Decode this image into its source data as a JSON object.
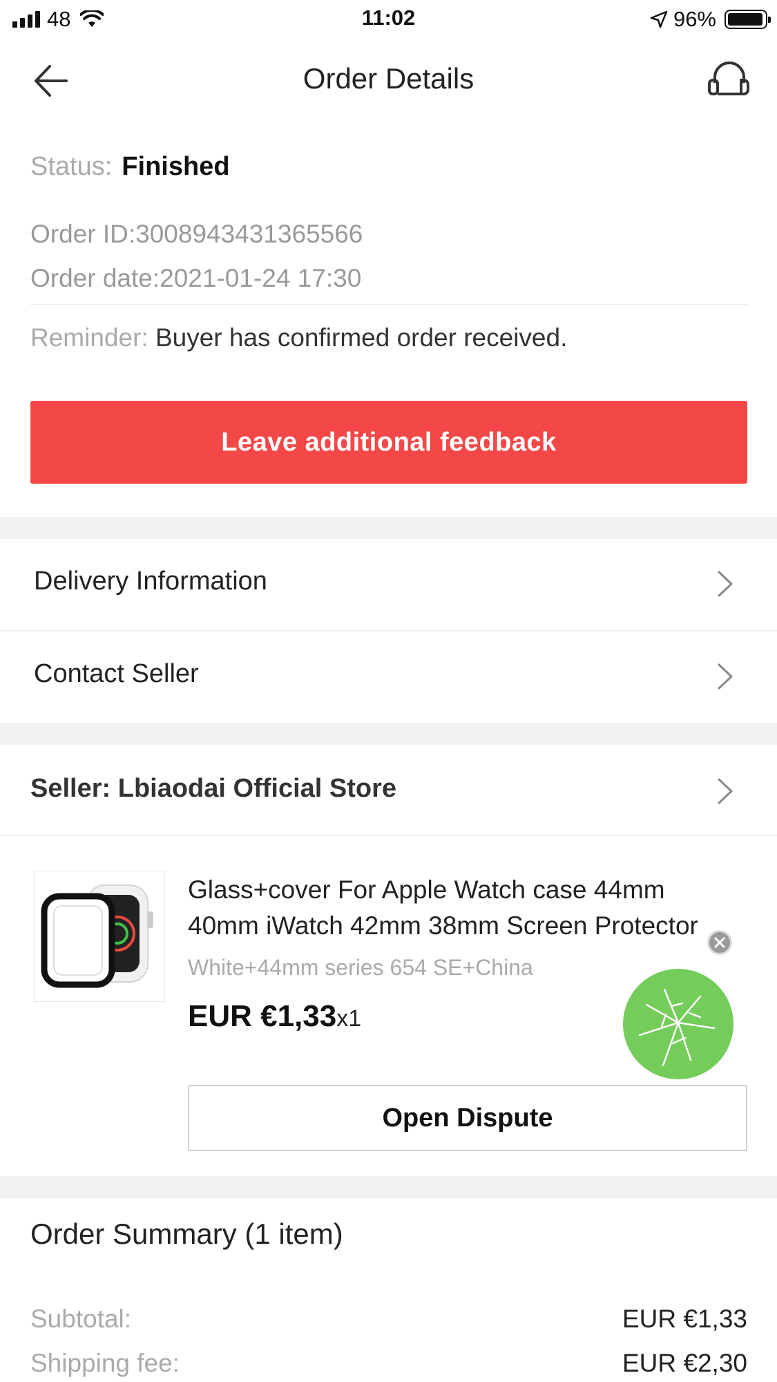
{
  "status_bar": {
    "carrier": "48",
    "time": "11:02",
    "battery": "96%"
  },
  "nav": {
    "title": "Order Details",
    "back_icon": "arrow-left-icon",
    "support_icon": "headset-icon"
  },
  "order": {
    "status_label": "Status:",
    "status_value": "Finished",
    "id_line": "Order ID:3008943431365566",
    "date_line": "Order date:2021-01-24 17:30",
    "reminder_label": "Reminder:",
    "reminder_text": "Buyer has confirmed order received."
  },
  "actions": {
    "feedback_label": "Leave additional feedback",
    "feedback_color": "#f44848"
  },
  "links": {
    "delivery": "Delivery Information",
    "contact": "Contact Seller"
  },
  "seller": {
    "label": "Seller: Lbiaodai Official Store"
  },
  "product": {
    "title": "Glass+cover For Apple Watch case 44mm 40mm iWatch 42mm 38mm Screen Protector",
    "variant": "White+44mm series 654 SE+China",
    "price": "EUR €1,33",
    "qty": "x1",
    "dispute_label": "Open Dispute"
  },
  "summary": {
    "title": "Order Summary (1 item)",
    "subtotal_label": "Subtotal:",
    "subtotal_value": "EUR €1,33",
    "shipping_label": "Shipping fee:",
    "shipping_value": "EUR €2,30"
  }
}
